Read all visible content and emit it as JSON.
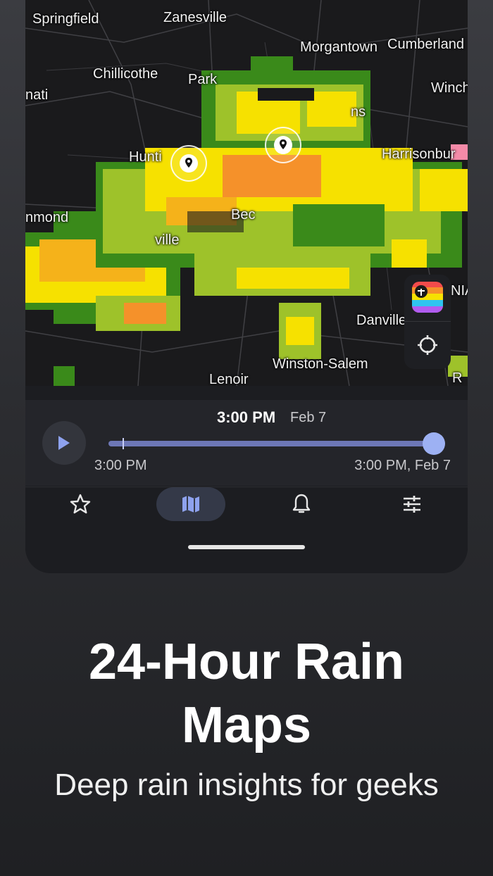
{
  "map": {
    "cities": {
      "springfield": "Springfield",
      "zanesville": "Zanesville",
      "morgantown": "Morgantown",
      "cumberland": "Cumberland",
      "chillicothe": "Chillicothe",
      "park": "Park",
      "nati": "nati",
      "winch": "Winch",
      "ns": "ns",
      "hunt": "Hunti",
      "harrisonburg": "Harrisonbur",
      "mond": "nmond",
      "bec": "Bec",
      "ville": "ville",
      "nia": "NIA",
      "danville": "Danville",
      "winston_salem": "Winston-Salem",
      "lenoir": "Lenoir",
      "r": "R"
    },
    "pins": [
      "location-pin-1",
      "location-pin-2"
    ],
    "colors": {
      "rain_heavy": "#f5912a",
      "rain_mid": "#f6e100",
      "rain_light": "#9ec22a",
      "rain_min": "#3a8a1a",
      "map_bg": "#1a1a1c"
    }
  },
  "controls": {
    "app_logo": "app-logo-icon",
    "locate": "crosshair-icon"
  },
  "timeline": {
    "current_time": "3:00 PM",
    "current_date": "Feb 7",
    "start_label": "3:00 PM",
    "end_label": "3:00 PM, Feb 7",
    "progress": 1.0,
    "accent": "#9db1f3"
  },
  "tabs": [
    {
      "icon": "star-icon",
      "active": false
    },
    {
      "icon": "map-icon",
      "active": true
    },
    {
      "icon": "bell-icon",
      "active": false
    },
    {
      "icon": "sliders-icon",
      "active": false
    }
  ],
  "promo": {
    "headline_line1": "24-Hour Rain",
    "headline_line2": "Maps",
    "subheadline": "Deep rain insights for geeks"
  }
}
